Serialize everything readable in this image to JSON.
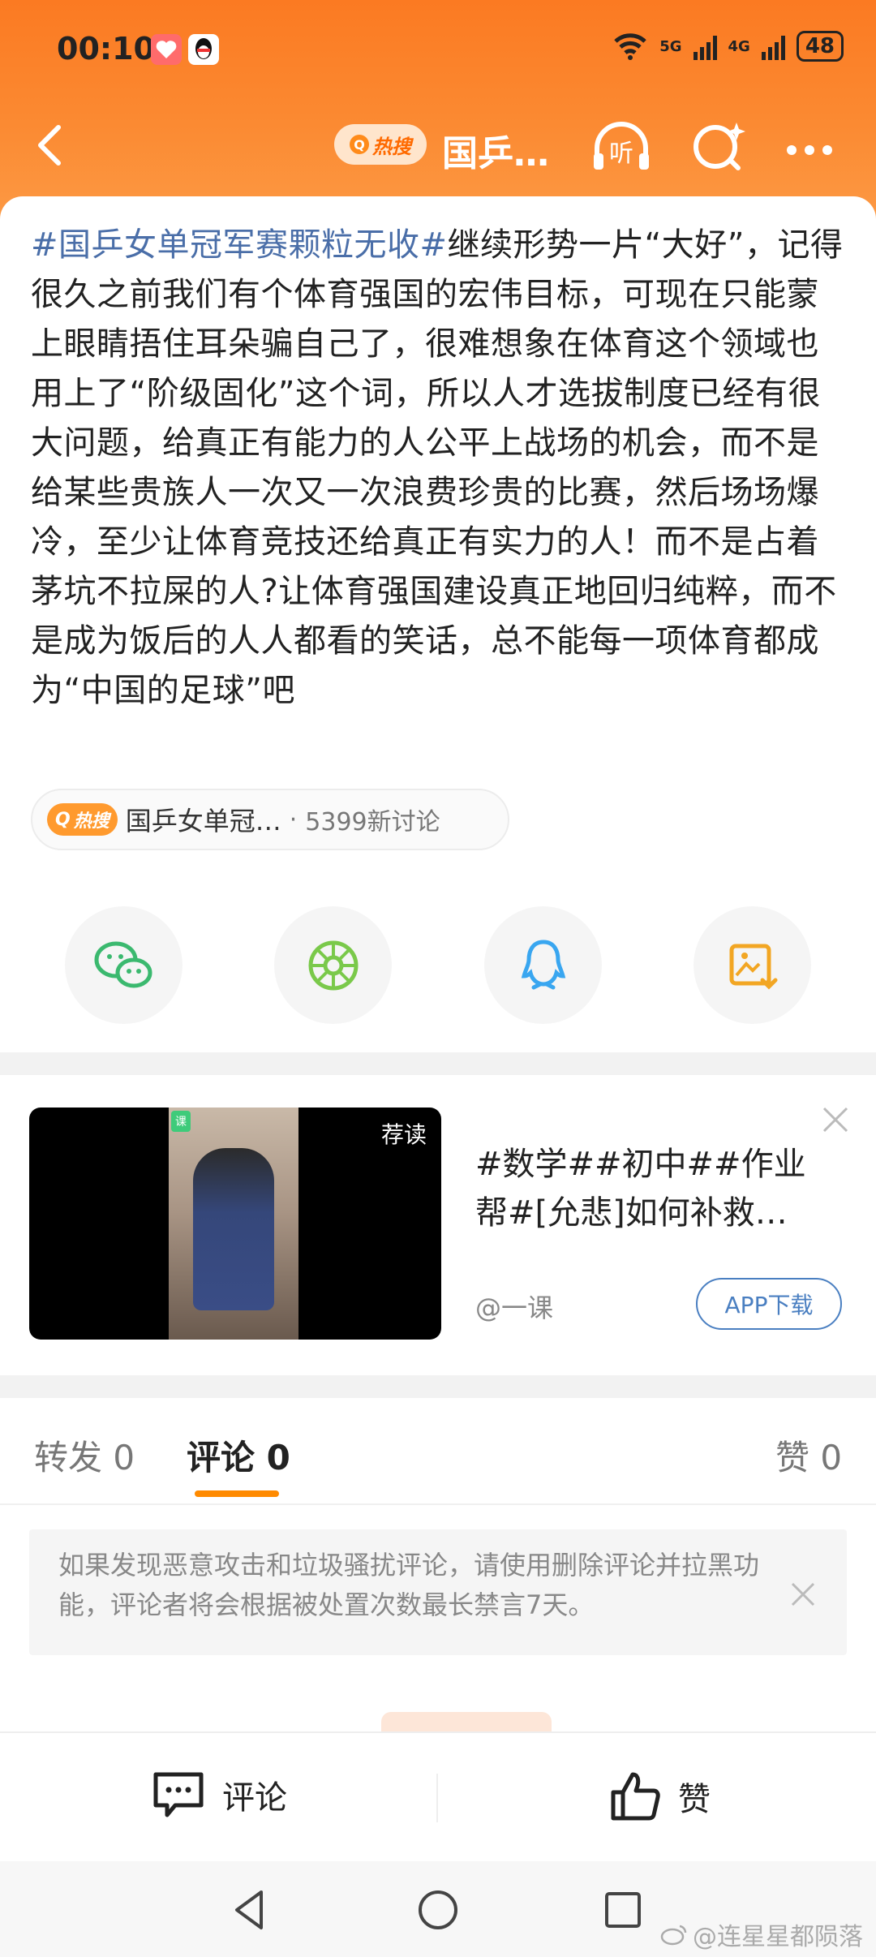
{
  "status_bar": {
    "time": "00:10",
    "network_1": "5G",
    "network_2": "4G",
    "battery": "48"
  },
  "nav": {
    "hot_badge": "热搜",
    "title": "国乒…",
    "listen_label": "听"
  },
  "post": {
    "hashtag": "#国乒女单冠军赛颗粒无收#",
    "body": "继续形势一片“大好”，记得很久之前我们有个体育强国的宏伟目标，可现在只能蒙上眼睛捂住耳朵骗自己了，很难想象在体育这个领域也用上了“阶级固化”这个词，所以人才选拔制度已经有很大问题，给真正有能力的人公平上战场的机会，而不是给某些贵族人一次又一次浪费珍贵的比赛，然后场场爆冷，至少让体育竞技还给真正有实力的人！而不是占着茅坑不拉屎的人?让体育强国建设真正地回归纯粹，而不是成为饭后的人人都看的笑话，总不能每一项体育都成为“中国的足球”吧"
  },
  "topic_chip": {
    "hot_label": "热搜",
    "name": "国乒女单冠…",
    "separator": "·",
    "count": "5399新讨论"
  },
  "share": {
    "items": [
      "wechat-icon",
      "moments-icon",
      "qq-icon",
      "save-image-icon"
    ]
  },
  "ad": {
    "recommend_label": "荐读",
    "course_badge": "课",
    "title": "#数学##初中##作业帮#[允悲]如何补救…",
    "source": "@一课",
    "download_label": "APP下载"
  },
  "tabs": {
    "repost": "转发",
    "repost_count": "0",
    "comment": "评论",
    "comment_count": "0",
    "like": "赞",
    "like_count": "0"
  },
  "notice": {
    "text": "如果发现恶意攻击和垃圾骚扰评论，请使用删除评论并拉黑功能，评论者将会根据被处置次数最长禁言7天。"
  },
  "bottom_bar": {
    "comment_label": "评论",
    "like_label": "赞"
  },
  "watermark": {
    "text": "@连星星都陨落"
  },
  "colors": {
    "header_orange": "#fb7a22",
    "hashtag_blue": "#4a6ea8",
    "tab_accent": "#ff8a00",
    "download_blue": "#4a7fc1"
  }
}
